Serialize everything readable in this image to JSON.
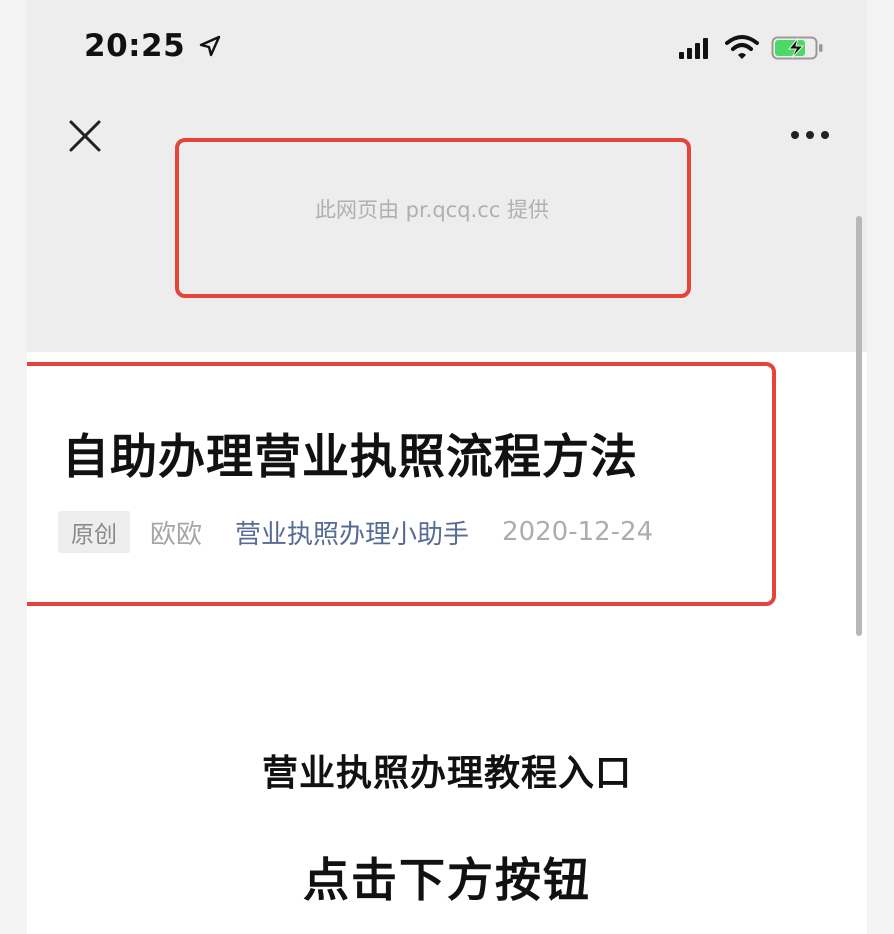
{
  "status_bar": {
    "time": "20:25",
    "icons": [
      "location-arrow-icon",
      "cellular-signal-icon",
      "wifi-icon",
      "battery-charging-icon"
    ]
  },
  "nav": {
    "close_icon": "close-icon",
    "more_icon": "more-dots-icon",
    "provider_text": "此网页由 pr.qcq.cc 提供"
  },
  "article": {
    "title": "自助办理营业执照流程方法",
    "tag": "原创",
    "author": "欧欧",
    "account": "营业执照办理小助手",
    "date": "2020-12-24"
  },
  "content": {
    "heading": "营业执照办理教程入口",
    "instruction": "点击下方按钮"
  },
  "colors": {
    "highlight": "#e5443a",
    "account_link": "#576b95",
    "battery": "#4cd964",
    "top_background": "#ededed"
  }
}
